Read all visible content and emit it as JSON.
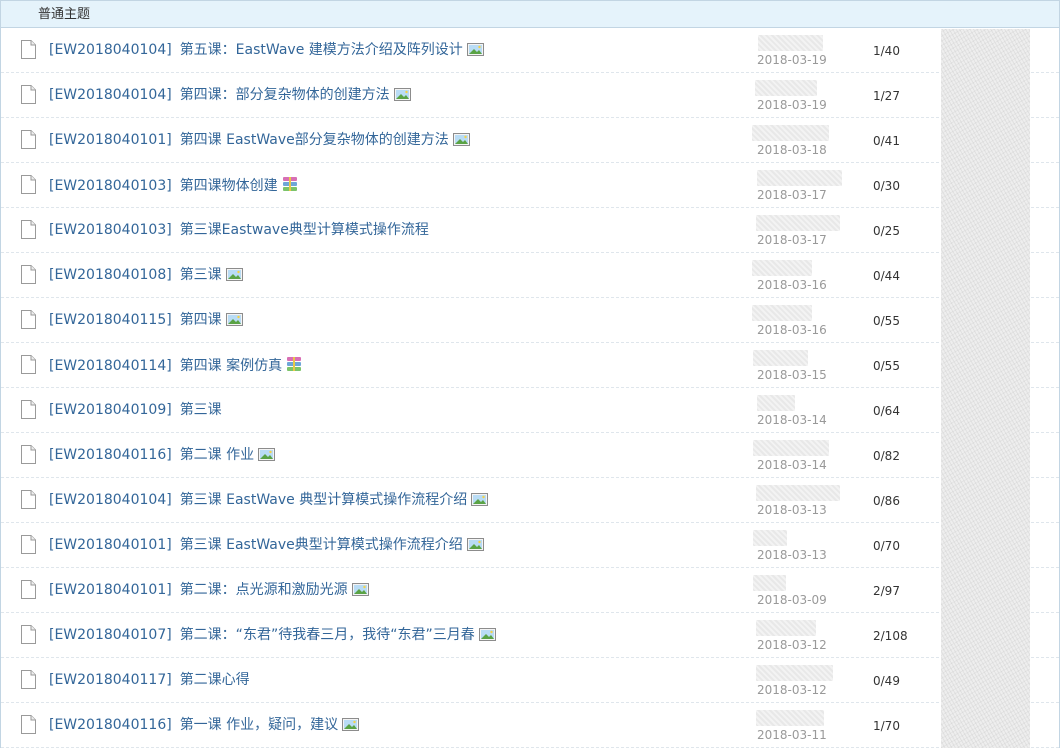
{
  "section": {
    "title": "普通主题"
  },
  "colors": {
    "header_bg": "#e5f3fb",
    "border": "#c2d5e3",
    "link": "#336699",
    "date": "#999999"
  },
  "threads": [
    {
      "code": "[EW2018040104]",
      "title": "第五课：EastWave 建模方法介绍及阵列设计",
      "attach": "image-icon",
      "date": "2018-03-19",
      "stats": "1/40"
    },
    {
      "code": "[EW2018040104]",
      "title": "第四课：部分复杂物体的创建方法",
      "attach": "image-icon",
      "date": "2018-03-19",
      "stats": "1/27"
    },
    {
      "code": "[EW2018040101]",
      "title": "第四课 EastWave部分复杂物体的创建方法",
      "attach": "image-icon",
      "date": "2018-03-18",
      "stats": "0/41"
    },
    {
      "code": "[EW2018040103]",
      "title": "第四课物体创建",
      "attach": "archive-icon",
      "date": "2018-03-17",
      "stats": "0/30"
    },
    {
      "code": "[EW2018040103]",
      "title": "第三课Eastwave典型计算模式操作流程",
      "attach": "",
      "date": "2018-03-17",
      "stats": "0/25"
    },
    {
      "code": "[EW2018040108]",
      "title": "第三课",
      "attach": "image-icon",
      "date": "2018-03-16",
      "stats": "0/44"
    },
    {
      "code": "[EW2018040115]",
      "title": "第四课",
      "attach": "image-icon",
      "date": "2018-03-16",
      "stats": "0/55"
    },
    {
      "code": "[EW2018040114]",
      "title": "第四课 案例仿真",
      "attach": "archive-icon",
      "date": "2018-03-15",
      "stats": "0/55"
    },
    {
      "code": "[EW2018040109]",
      "title": "第三课",
      "attach": "",
      "date": "2018-03-14",
      "stats": "0/64"
    },
    {
      "code": "[EW2018040116]",
      "title": "第二课 作业",
      "attach": "image-icon",
      "date": "2018-03-14",
      "stats": "0/82"
    },
    {
      "code": "[EW2018040104]",
      "title": "第三课 EastWave 典型计算模式操作流程介绍",
      "attach": "image-icon",
      "date": "2018-03-13",
      "stats": "0/86"
    },
    {
      "code": "[EW2018040101]",
      "title": "第三课 EastWave典型计算模式操作流程介绍",
      "attach": "image-icon",
      "date": "2018-03-13",
      "stats": "0/70"
    },
    {
      "code": "[EW2018040101]",
      "title": "第二课：点光源和激励光源",
      "attach": "image-icon",
      "date": "2018-03-09",
      "stats": "2/97"
    },
    {
      "code": "[EW2018040107]",
      "title": "第二课：“东君”待我春三月，我待“东君”三月春",
      "attach": "image-icon",
      "date": "2018-03-12",
      "stats": "2/108"
    },
    {
      "code": "[EW2018040117]",
      "title": "第二课心得",
      "attach": "",
      "date": "2018-03-12",
      "stats": "0/49"
    },
    {
      "code": "[EW2018040116]",
      "title": "第一课  作业，疑问，建议",
      "attach": "image-icon",
      "date": "2018-03-11",
      "stats": "1/70"
    }
  ]
}
